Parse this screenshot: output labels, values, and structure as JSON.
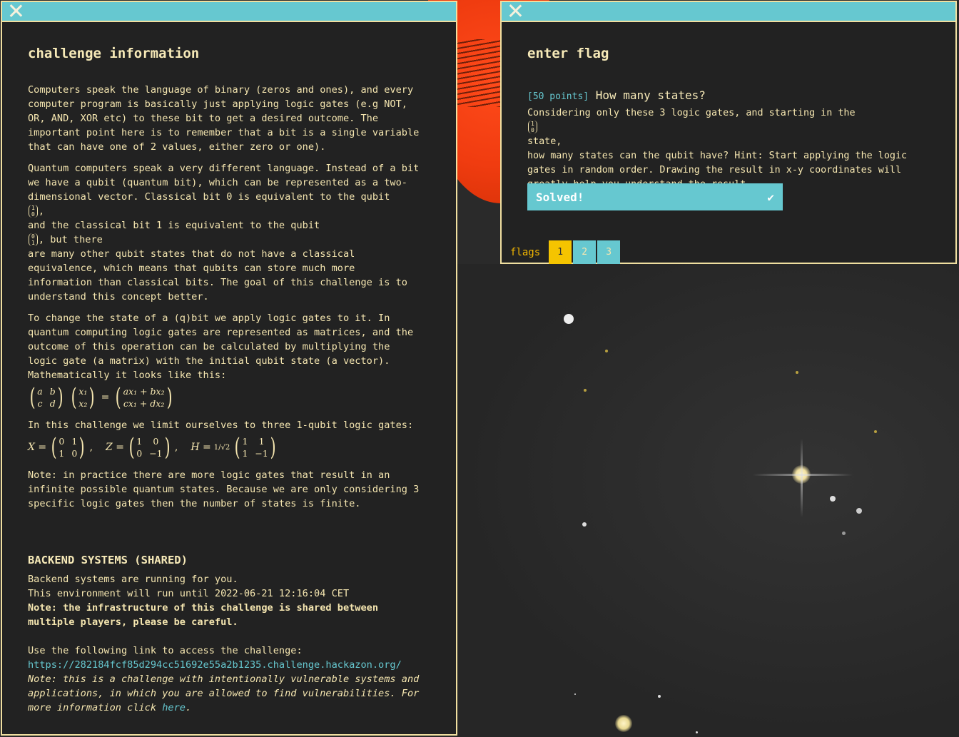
{
  "left_window": {
    "title": "challenge information",
    "p1": "Computers speak the language of binary (zeros and ones), and every\ncomputer program is basically just applying logic gates (e.g NOT,\nOR, AND, XOR etc) to these bit to get a desired outcome. The\nimportant point here is to remember that a bit is a single variable\nthat can have one of 2 values, either zero or one).",
    "p2a": "Quantum computers speak a very different language. Instead of a bit\nwe have a qubit (quantum bit), which can be represented as a two-\ndimensional vector. Classical bit 0 is equivalent to the qubit",
    "p2b": "and the classical bit 1 is equivalent to the qubit",
    "p2b_end": ", but there",
    "p2c": "are many other qubit states that do not have a classical\nequivalence, which means that qubits can store much more\ninformation than classical bits. The goal of this challenge is to\nunderstand this concept better.",
    "p3": "To change the state of a (q)bit we apply logic gates to it. In\nquantum computing logic gates are represented as matrices, and the\noutcome of this operation can be calculated by multiplying the\nlogic gate (a matrix) with the initial qubit state (a vector).\nMathematically it looks like this:",
    "formula": {
      "m": [
        "a",
        "b",
        "c",
        "d"
      ],
      "v": [
        "x₁",
        "x₂"
      ],
      "eq": "=",
      "r": [
        "ax₁ + bx₂",
        "cx₁ + dx₂"
      ]
    },
    "p4": "In this challenge we limit ourselves to three 1-qubit logic gates:",
    "gates": {
      "x_label": "X =",
      "x_m": [
        "0",
        "1",
        "1",
        "0"
      ],
      "z_label": "Z =",
      "z_m": [
        "1",
        "0",
        "0",
        "−1"
      ],
      "h_label": "H =",
      "h_frac": "1/√2",
      "h_m": [
        "1",
        "1",
        "1",
        "−1"
      ],
      "sep": ","
    },
    "p5": "Note: in practice there are more logic gates that result in an\ninfinite possible quantum states. Because we are only considering 3\nspecific logic gates then the number of states is finite.",
    "backend_title": "BACKEND SYSTEMS (SHARED)",
    "backend_l1": "Backend systems are running for you.",
    "backend_l2": "This environment will run until 2022-06-21 12:16:04 CET",
    "backend_note": "Note: the infrastructure of this challenge is shared between\nmultiple players, please be careful.",
    "link_intro": "Use the following link to access the challenge:",
    "link_url": "https://282184fcf85d294cc51692e55a2b1235.challenge.hackazon.org/",
    "note_italic": "Note: this is a challenge with intentionally vulnerable systems and\napplications, in which you are allowed to find vulnerabilities. For\nmore information click",
    "here_link": "here",
    "period": "."
  },
  "right_window": {
    "title": "enter flag",
    "points": "[50 points]",
    "question_title": "How many states?",
    "q_a": "Considering only these 3 logic gates, and starting in the",
    "q_b": "state,",
    "q_c": "how many states can the qubit have? Hint: Start applying the logic\ngates in random order. Drawing the result in x-y coordinates will\ngreatly help you understand the result.",
    "solved_label": "Solved!",
    "flags_label": "flags",
    "flag_tabs": [
      "1",
      "2",
      "3"
    ]
  },
  "vectors": {
    "zero": [
      "1",
      "0"
    ],
    "one": [
      "0",
      "1"
    ]
  },
  "colors": {
    "accent": "#66c8d0",
    "text": "#f5e6b0",
    "window_bg": "#222222",
    "active_tab": "#f5c400",
    "background_red": "#f03c10"
  }
}
